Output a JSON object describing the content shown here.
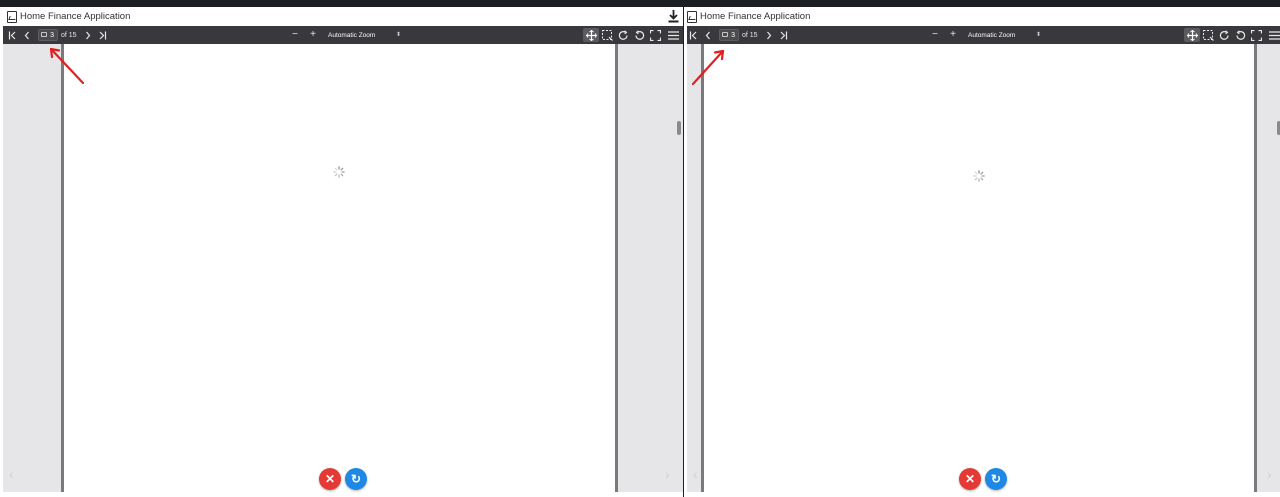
{
  "panes": [
    {
      "title": "Home Finance Application",
      "toolbar": {
        "page_current": "3",
        "page_of": "of 15",
        "zoom_minus": "−",
        "zoom_plus": "+",
        "zoom_value": "Automatic Zoom"
      },
      "buttons": {
        "cancel_icon": "✕",
        "refresh_icon": "↻"
      }
    },
    {
      "title": "Home Finance Application",
      "toolbar": {
        "page_current": "3",
        "page_of": "of 15",
        "zoom_minus": "−",
        "zoom_plus": "+",
        "zoom_value": "Automatic Zoom"
      },
      "buttons": {
        "cancel_icon": "✕",
        "refresh_icon": "↻"
      }
    }
  ],
  "colors": {
    "toolbar_bg": "#38383d",
    "viewer_bg": "#e6e6e9",
    "cancel": "#e53935",
    "refresh": "#1e88e5",
    "annotation_arrow": "#e02020"
  },
  "icons": {
    "first_page": "first-page-icon",
    "prev_page": "chevron-left-icon",
    "next_page": "chevron-right-icon",
    "last_page": "last-page-icon",
    "pan": "hand-pan-icon",
    "select": "marquee-select-icon",
    "rotate_cw": "rotate-clockwise-icon",
    "rotate_ccw": "rotate-counterclockwise-icon",
    "fullscreen": "fullscreen-icon",
    "menu": "hamburger-menu-icon",
    "download": "download-icon",
    "loading": "loading-spinner-icon"
  }
}
